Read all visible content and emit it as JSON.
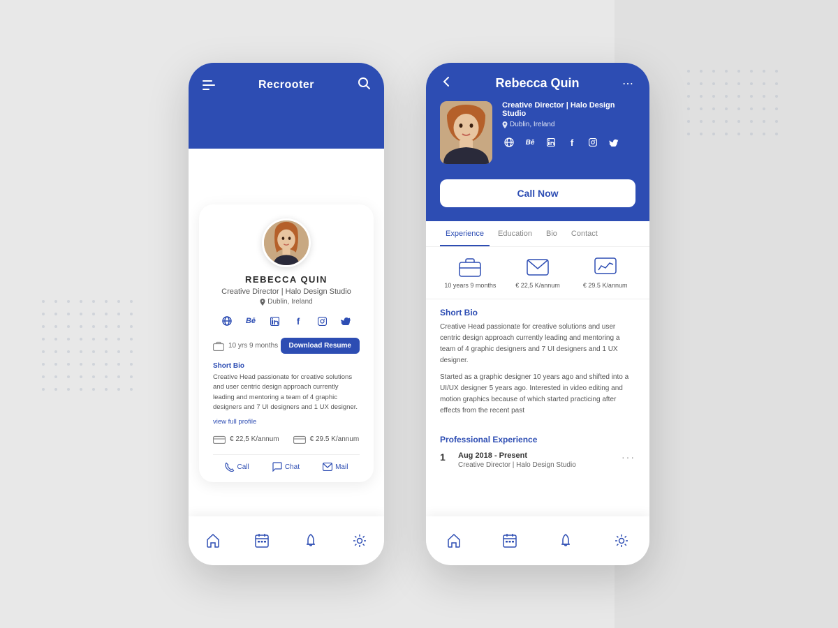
{
  "app": {
    "title": "Recrooter"
  },
  "profile": {
    "name": "REBECCA QUIN",
    "name_display": "Rebecca Quin",
    "title": "Creative Director | Halo Design Studio",
    "location": "Dublin, Ireland",
    "experience": "10 yrs 9 months",
    "salary_min": "€ 22,5 K/annum",
    "salary_max": "€ 29.5 K/annum",
    "short_bio_title": "Short Bio",
    "short_bio": "Creative Head passionate for creative solutions and user centric design approach currently leading and mentoring a team of 4 graphic designers and 7 UI designers and 1 UX designer.",
    "short_bio_extended": "Started as a graphic designer 10 years ago and shifted into a UI/UX designer 5 years ago. Interested in video editing and motion graphics because of which started practicing after effects from the recent past",
    "view_full": "view full profile",
    "download_resume": "Download Resume",
    "call_now": "Call Now",
    "professional_exp_title": "Professional Experience",
    "exp_1_date": "Aug 2018 - Present",
    "exp_1_role": "Creative Director | Halo Design Studio"
  },
  "tabs": {
    "experience": "Experience",
    "education": "Education",
    "bio": "Bio",
    "contact": "Contact"
  },
  "stats": {
    "experience_years": "10 years 9 months",
    "salary_min": "€ 22,5 K/annum",
    "salary_max": "€ 29.5 K/annum"
  },
  "actions": {
    "call": "Call",
    "chat": "Chat",
    "mail": "Mail"
  },
  "nav": {
    "home": "home",
    "calendar": "calendar",
    "bell": "bell",
    "settings": "settings"
  },
  "colors": {
    "primary": "#2d4db3",
    "white": "#ffffff",
    "gray_bg": "#e8e8e8",
    "text_dark": "#2a2a2a",
    "text_mid": "#555555",
    "text_light": "#888888"
  },
  "social_icons": [
    "globe",
    "Be",
    "in",
    "f",
    "inst",
    "tw"
  ]
}
